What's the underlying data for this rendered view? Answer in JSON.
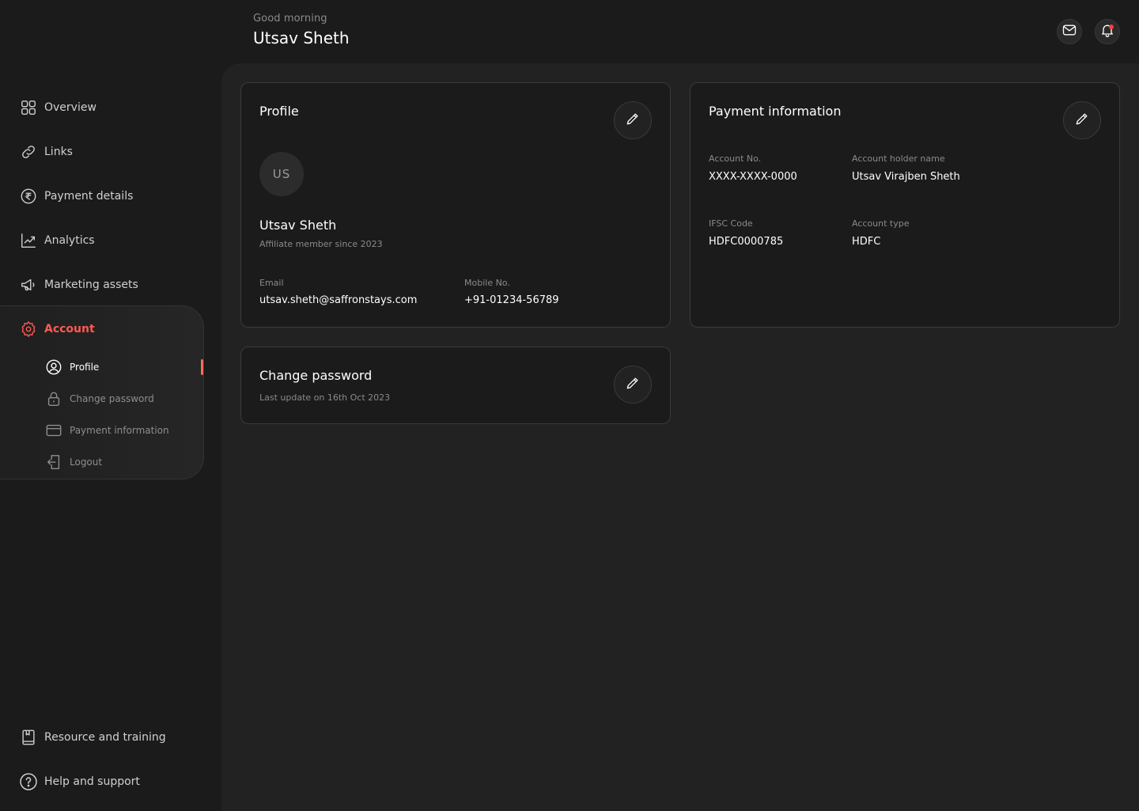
{
  "header": {
    "greeting": "Good morning",
    "user_name": "Utsav Sheth",
    "mail_icon": "mail-icon",
    "bell_icon": "bell-icon"
  },
  "sidebar": {
    "items": [
      {
        "label": "Overview",
        "icon": "grid-icon"
      },
      {
        "label": "Links",
        "icon": "link-icon"
      },
      {
        "label": "Payment details",
        "icon": "rupee-icon"
      },
      {
        "label": "Analytics",
        "icon": "chart-icon"
      },
      {
        "label": "Marketing assets",
        "icon": "megaphone-icon"
      },
      {
        "label": "Account",
        "icon": "gear-icon"
      }
    ],
    "account_sub": [
      {
        "label": "Profile",
        "icon": "user-circle-icon"
      },
      {
        "label": "Change password",
        "icon": "lock-icon"
      },
      {
        "label": "Payment information",
        "icon": "card-icon"
      },
      {
        "label": "Logout",
        "icon": "logout-icon"
      }
    ],
    "bottom": [
      {
        "label": "Resource and training",
        "icon": "book-icon"
      },
      {
        "label": "Help and support",
        "icon": "help-icon"
      }
    ]
  },
  "profile_card": {
    "title": "Profile",
    "avatar_initials": "US",
    "name": "Utsav Sheth",
    "member_since": "Affiliate member since 2023",
    "email_label": "Email",
    "email_value": "utsav.sheth@saffronstays.com",
    "mobile_label": "Mobile No.",
    "mobile_value": "+91-01234-56789"
  },
  "payment_card": {
    "title": "Payment information",
    "account_no_label": "Account No.",
    "account_no_value": "XXXX-XXXX-0000",
    "holder_label": "Account holder name",
    "holder_value": "Utsav Virajben Sheth",
    "ifsc_label": "IFSC Code",
    "ifsc_value": "HDFC0000785",
    "type_label": "Account type",
    "type_value": "HDFC"
  },
  "password_card": {
    "title": "Change password",
    "last_update": "Last update on 16th Oct 2023"
  },
  "colors": {
    "accent": "#ff5a52",
    "background": "#1b1b1b",
    "panel": "#222222"
  }
}
